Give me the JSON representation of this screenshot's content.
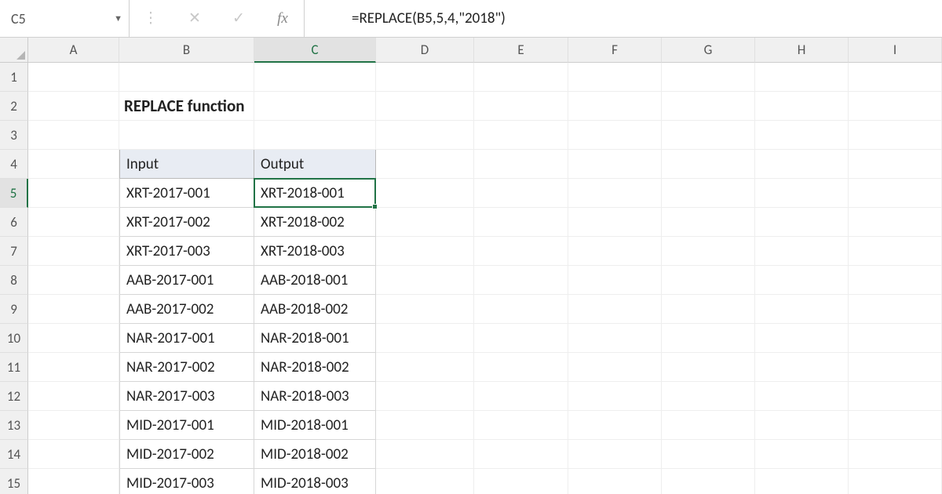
{
  "formula_bar": {
    "name_box": "C5",
    "formula": "=REPLACE(B5,5,4,\"2018\")"
  },
  "columns": [
    "A",
    "B",
    "C",
    "D",
    "E",
    "F",
    "G",
    "H",
    "I"
  ],
  "rows": [
    "1",
    "2",
    "3",
    "4",
    "5",
    "6",
    "7",
    "8",
    "9",
    "10",
    "11",
    "12",
    "13",
    "14",
    "15"
  ],
  "active_cell": {
    "row": "5",
    "col": "C"
  },
  "title": "REPLACE function",
  "table": {
    "headers": {
      "input": "Input",
      "output": "Output"
    },
    "data": [
      {
        "input": "XRT-2017-001",
        "output": "XRT-2018-001"
      },
      {
        "input": "XRT-2017-002",
        "output": "XRT-2018-002"
      },
      {
        "input": "XRT-2017-003",
        "output": "XRT-2018-003"
      },
      {
        "input": "AAB-2017-001",
        "output": "AAB-2018-001"
      },
      {
        "input": "AAB-2017-002",
        "output": "AAB-2018-002"
      },
      {
        "input": "NAR-2017-001",
        "output": "NAR-2018-001"
      },
      {
        "input": "NAR-2017-002",
        "output": "NAR-2018-002"
      },
      {
        "input": "NAR-2017-003",
        "output": "NAR-2018-003"
      },
      {
        "input": "MID-2017-001",
        "output": "MID-2018-001"
      },
      {
        "input": "MID-2017-002",
        "output": "MID-2018-002"
      },
      {
        "input": "MID-2017-003",
        "output": "MID-2018-003"
      }
    ]
  }
}
